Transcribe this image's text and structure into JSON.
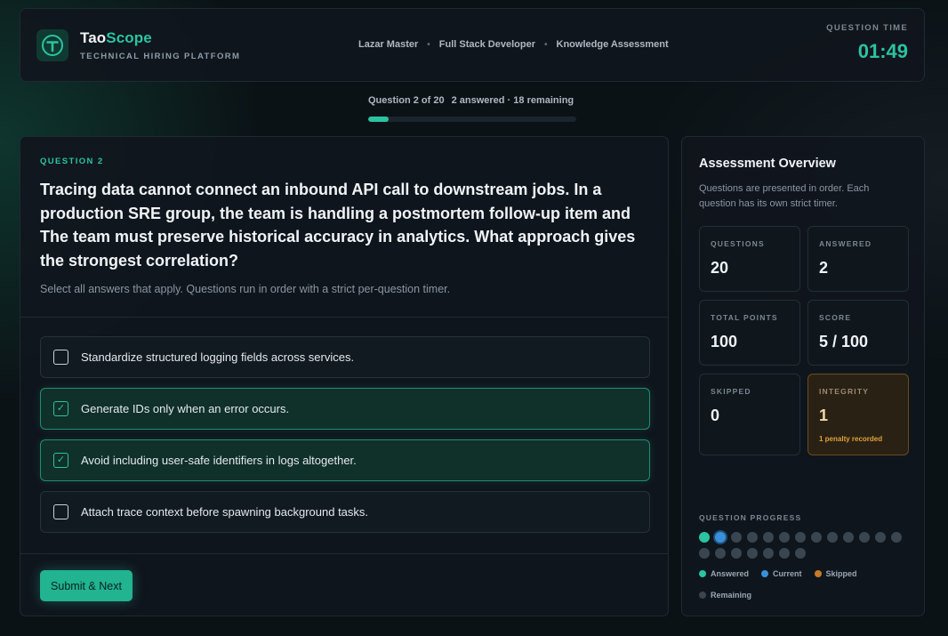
{
  "header": {
    "brand_prefix": "Tao",
    "brand_suffix": "Scope",
    "brand_sub": "TECHNICAL HIRING PLATFORM",
    "breadcrumbs": [
      "Lazar Master",
      "Full Stack Developer",
      "Knowledge Assessment"
    ],
    "timer_label": "QUESTION TIME",
    "timer_value": "01:49"
  },
  "progress": {
    "position": "Question 2 of 20",
    "summary": "2 answered · 18 remaining",
    "fraction": 0.1
  },
  "question": {
    "label": "QUESTION 2",
    "text": "Tracing data cannot connect an inbound API call to downstream jobs. In a production SRE group, the team is handling a postmortem follow-up item and The team must preserve historical accuracy in analytics. What approach gives the strongest correlation?",
    "hint": "Select all answers that apply. Questions run in order with a strict per-question timer.",
    "options": [
      {
        "text": "Standardize structured logging fields across services.",
        "selected": false
      },
      {
        "text": "Generate IDs only when an error occurs.",
        "selected": true
      },
      {
        "text": "Avoid including user-safe identifiers in logs altogether.",
        "selected": true
      },
      {
        "text": "Attach trace context before spawning background tasks.",
        "selected": false
      }
    ],
    "check_glyph": "✓",
    "submit_label": "Submit & Next"
  },
  "overview": {
    "title": "Assessment Overview",
    "description": "Questions are presented in order. Each question has its own strict timer.",
    "stats": {
      "questions": {
        "label": "QUESTIONS",
        "value": "20"
      },
      "answered": {
        "label": "ANSWERED",
        "value": "2"
      },
      "total_points": {
        "label": "TOTAL POINTS",
        "value": "100"
      },
      "score": {
        "label": "SCORE",
        "value": "5 / 100"
      },
      "skipped": {
        "label": "SKIPPED",
        "value": "0"
      },
      "integrity": {
        "label": "INTEGRITY",
        "value": "1",
        "note": "1 penalty recorded"
      }
    },
    "question_progress_label": "QUESTION PROGRESS",
    "question_states": [
      "answered",
      "current",
      "remaining",
      "remaining",
      "remaining",
      "remaining",
      "remaining",
      "remaining",
      "remaining",
      "remaining",
      "remaining",
      "remaining",
      "remaining",
      "remaining",
      "remaining",
      "remaining",
      "remaining",
      "remaining",
      "remaining",
      "remaining"
    ],
    "legend": [
      {
        "label": "Answered",
        "color": "#2bc3a0"
      },
      {
        "label": "Current",
        "color": "#3a8fd9"
      },
      {
        "label": "Skipped",
        "color": "#c77a28"
      },
      {
        "label": "Remaining",
        "color": "#3a4550"
      }
    ]
  },
  "colors": {
    "accent": "#2bc3a0",
    "warning": "#e0a23a"
  }
}
